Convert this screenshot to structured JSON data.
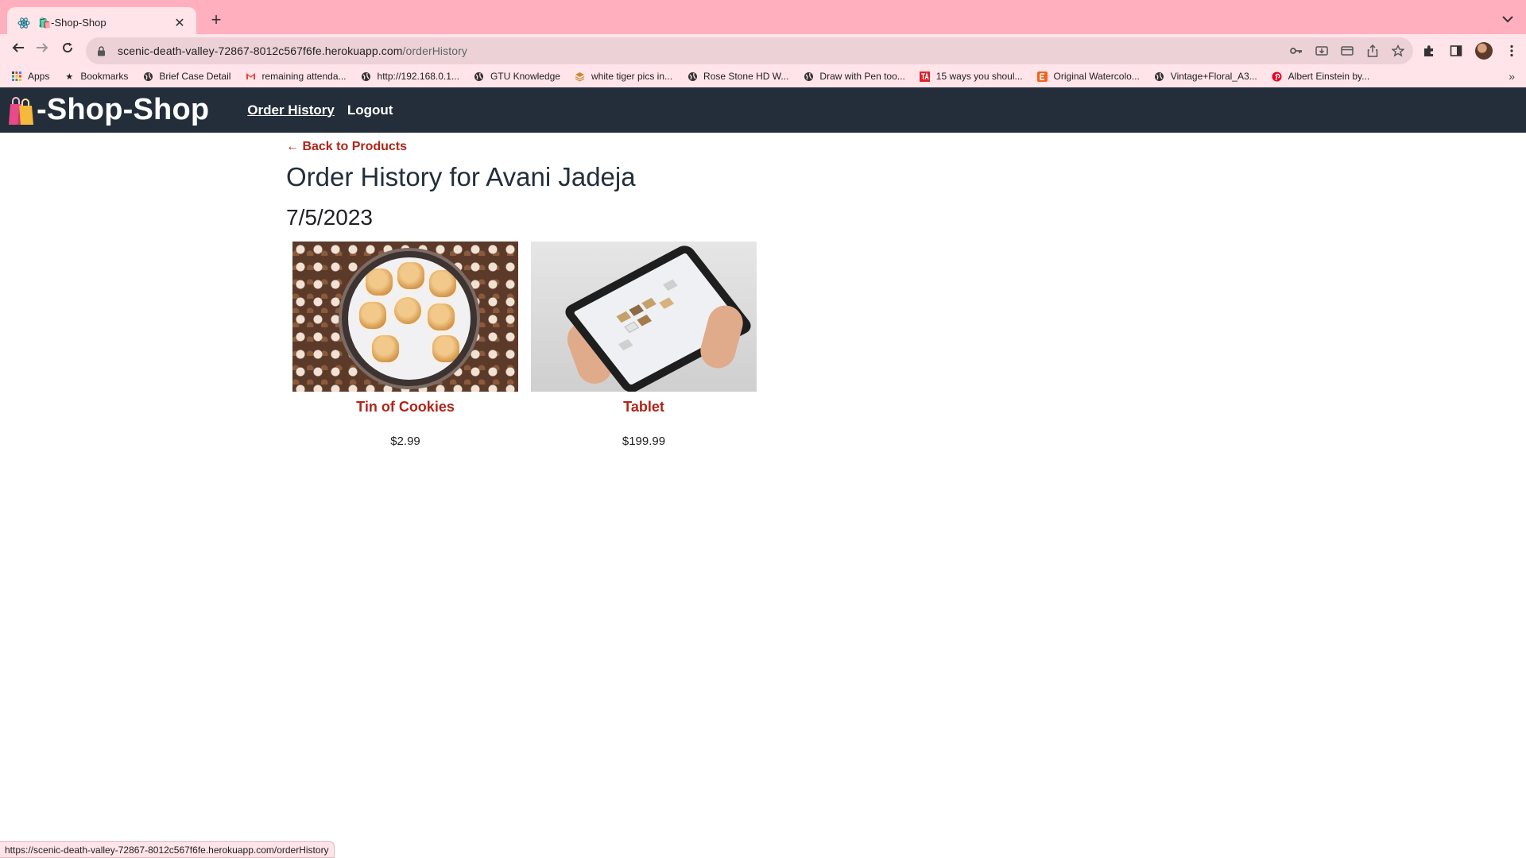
{
  "browser": {
    "tab_title": "🛍️-Shop-Shop",
    "url_host": "scenic-death-valley-72867-8012c567f6fe.herokuapp.com",
    "url_path": "/orderHistory",
    "bookmarks": [
      {
        "label": "Apps",
        "icon": "apps-grid-icon"
      },
      {
        "label": "Bookmarks",
        "icon": "star-icon"
      },
      {
        "label": "Brief Case Detail",
        "icon": "globe-icon"
      },
      {
        "label": "remaining attenda...",
        "icon": "gmail-icon"
      },
      {
        "label": "http://192.168.0.1...",
        "icon": "globe-icon"
      },
      {
        "label": "GTU Knowledge",
        "icon": "globe-icon"
      },
      {
        "label": "white tiger pics in...",
        "icon": "stack-icon"
      },
      {
        "label": "Rose Stone HD W...",
        "icon": "globe-icon"
      },
      {
        "label": "Draw with Pen too...",
        "icon": "globe-icon"
      },
      {
        "label": "15 ways you shoul...",
        "icon": "ta-icon"
      },
      {
        "label": "Original Watercolo...",
        "icon": "etsy-icon"
      },
      {
        "label": "Vintage+Floral_A3...",
        "icon": "globe-icon"
      },
      {
        "label": "Albert Einstein by...",
        "icon": "pinterest-icon"
      }
    ],
    "status_url": "https://scenic-death-valley-72867-8012c567f6fe.herokuapp.com/orderHistory"
  },
  "header": {
    "brand": "-Shop-Shop",
    "nav": [
      {
        "label": "Order History"
      },
      {
        "label": "Logout"
      }
    ]
  },
  "main": {
    "back_link": "← Back to Products",
    "title": "Order History for Avani Jadeja",
    "orders": [
      {
        "date": "7/5/2023",
        "products": [
          {
            "name": "Tin of Cookies",
            "price": "$2.99",
            "image": "cookie-tin-image"
          },
          {
            "name": "Tablet",
            "price": "$199.99",
            "image": "tablet-image"
          }
        ]
      }
    ]
  },
  "colors": {
    "header_bg": "#242e3b",
    "accent_red": "#b12419",
    "browser_frame": "#ffafbd",
    "browser_toolbar": "#ffe4e9"
  }
}
